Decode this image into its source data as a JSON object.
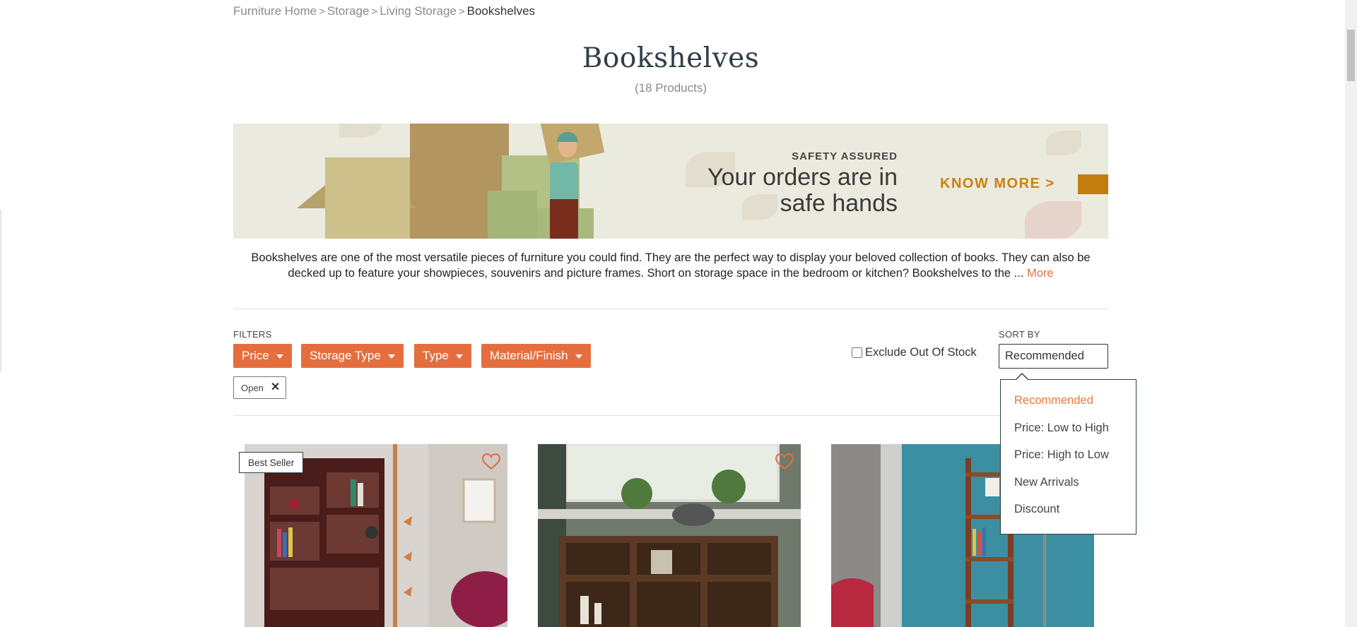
{
  "breadcrumb": {
    "items": [
      "Furniture Home",
      "Storage",
      "Living Storage"
    ],
    "current": "Bookshelves",
    "separator": ">"
  },
  "page": {
    "title": "Bookshelves",
    "count": "(18 Products)"
  },
  "banner": {
    "eyebrow": "SAFETY ASSURED",
    "headline_line1": "Your orders are in",
    "headline_line2": "safe hands",
    "cta": "KNOW MORE >"
  },
  "description": {
    "text": "Bookshelves are one of the most versatile pieces of furniture you could find. They are the perfect way to display your beloved collection of books. They can also be decked up to feature your showpieces, souvenirs and picture frames. Short on storage space in the bedroom or kitchen? Bookshelves to the ... ",
    "more_label": "More"
  },
  "filters": {
    "label": "FILTERS",
    "buttons": [
      "Price",
      "Storage Type",
      "Type",
      "Material/Finish"
    ],
    "applied_chip": "Open",
    "exclude_label": "Exclude Out Of Stock",
    "exclude_checked": false
  },
  "sort": {
    "label": "SORT BY",
    "selected": "Recommended",
    "options": [
      "Recommended",
      "Price: Low to High",
      "Price: High to Low",
      "New Arrivals",
      "Discount"
    ]
  },
  "products": {
    "badge": "Best Seller"
  },
  "colors": {
    "accent": "#e56e3f",
    "title": "#2f3e46",
    "banner_cta": "#c9820d",
    "muted": "#8a8a8a"
  }
}
